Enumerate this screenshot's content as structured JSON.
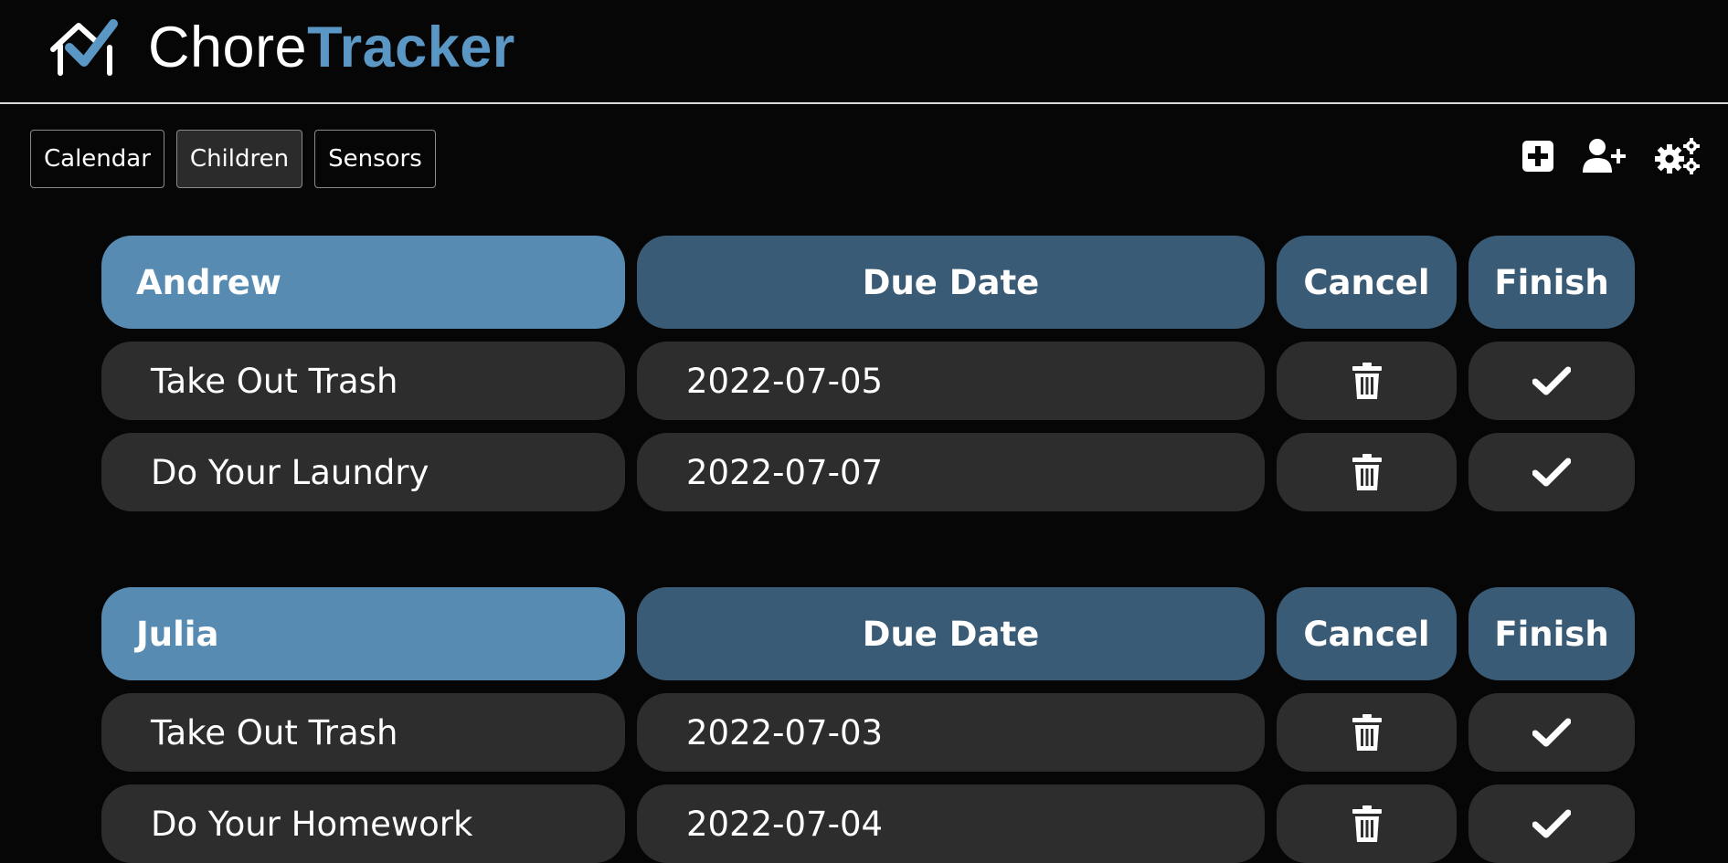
{
  "app": {
    "name_part1": "Chore",
    "name_part2": "Tracker"
  },
  "nav": {
    "tabs": [
      {
        "label": "Calendar",
        "active": false
      },
      {
        "label": "Children",
        "active": true
      },
      {
        "label": "Sensors",
        "active": false
      }
    ]
  },
  "toolbar": {
    "icons": [
      "plus-square-icon",
      "add-user-icon",
      "gears-icon"
    ]
  },
  "columns": {
    "due_date": "Due Date",
    "cancel": "Cancel",
    "finish": "Finish"
  },
  "children": [
    {
      "name": "Andrew",
      "chores": [
        {
          "chore": "Take Out Trash",
          "due": "2022-07-05"
        },
        {
          "chore": "Do Your Laundry",
          "due": "2022-07-07"
        }
      ]
    },
    {
      "name": "Julia",
      "chores": [
        {
          "chore": "Take Out Trash",
          "due": "2022-07-03"
        },
        {
          "chore": "Do Your Homework",
          "due": "2022-07-04"
        }
      ]
    }
  ],
  "colors": {
    "background": "#060606",
    "header_name": "#578bb1",
    "header_column": "#3a5b75",
    "row": "#2d2d2d",
    "brand_accent": "#5b97c4"
  }
}
